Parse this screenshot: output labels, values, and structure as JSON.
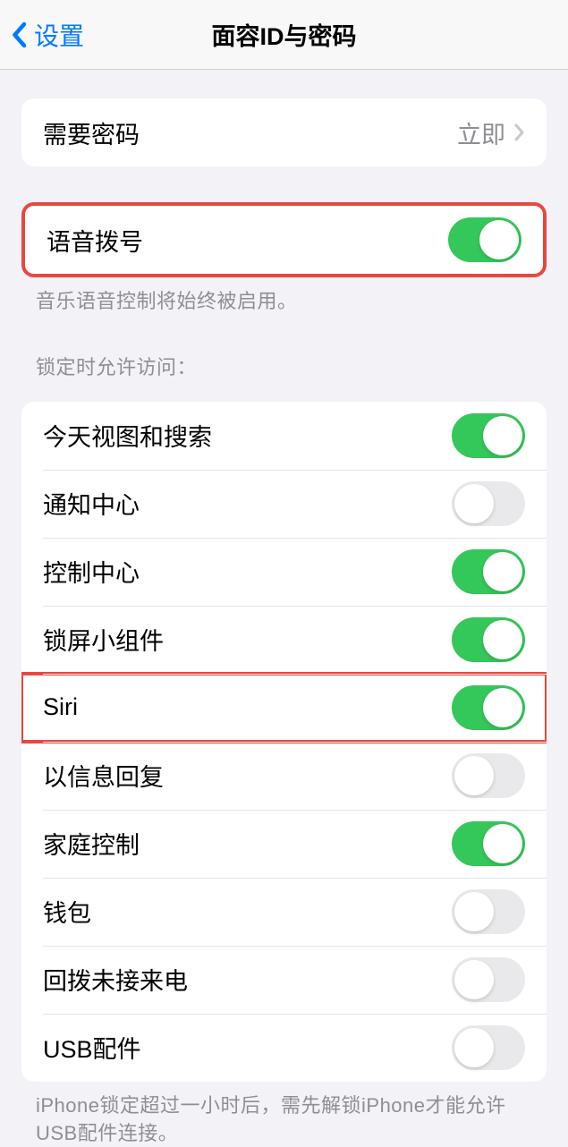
{
  "header": {
    "back_label": "设置",
    "title": "面容ID与密码"
  },
  "require_passcode": {
    "label": "需要密码",
    "value": "立即"
  },
  "voice_dial": {
    "label": "语音拨号",
    "footer": "音乐语音控制将始终被启用。",
    "enabled": true
  },
  "lock_screen_access": {
    "header": "锁定时允许访问：",
    "items": [
      {
        "label": "今天视图和搜索",
        "enabled": true
      },
      {
        "label": "通知中心",
        "enabled": false
      },
      {
        "label": "控制中心",
        "enabled": true
      },
      {
        "label": "锁屏小组件",
        "enabled": true
      },
      {
        "label": "Siri",
        "enabled": true
      },
      {
        "label": "以信息回复",
        "enabled": false
      },
      {
        "label": "家庭控制",
        "enabled": true
      },
      {
        "label": "钱包",
        "enabled": false
      },
      {
        "label": "回拨未接来电",
        "enabled": false
      },
      {
        "label": "USB配件",
        "enabled": false
      }
    ],
    "footer": "iPhone锁定超过一小时后，需先解锁iPhone才能允许USB配件连接。"
  },
  "highlighted_rows": [
    0,
    4
  ]
}
